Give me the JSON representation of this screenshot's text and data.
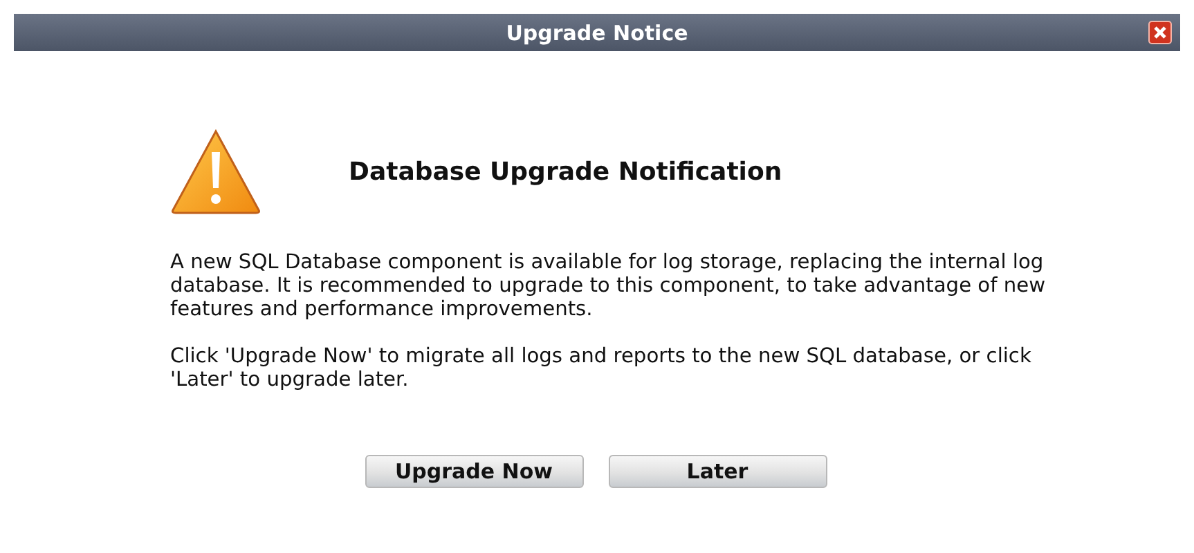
{
  "window": {
    "title": "Upgrade Notice"
  },
  "heading": "Database Upgrade Notification",
  "paragraphs": [
    "A new SQL Database component is available for log storage, replacing the internal log database. It is recommended to upgrade to this component, to take advantage of new features and performance improvements.",
    "Click 'Upgrade Now' to migrate all logs and reports to the new SQL database, or click 'Later' to upgrade later."
  ],
  "buttons": [
    "Upgrade Now",
    "Later"
  ]
}
